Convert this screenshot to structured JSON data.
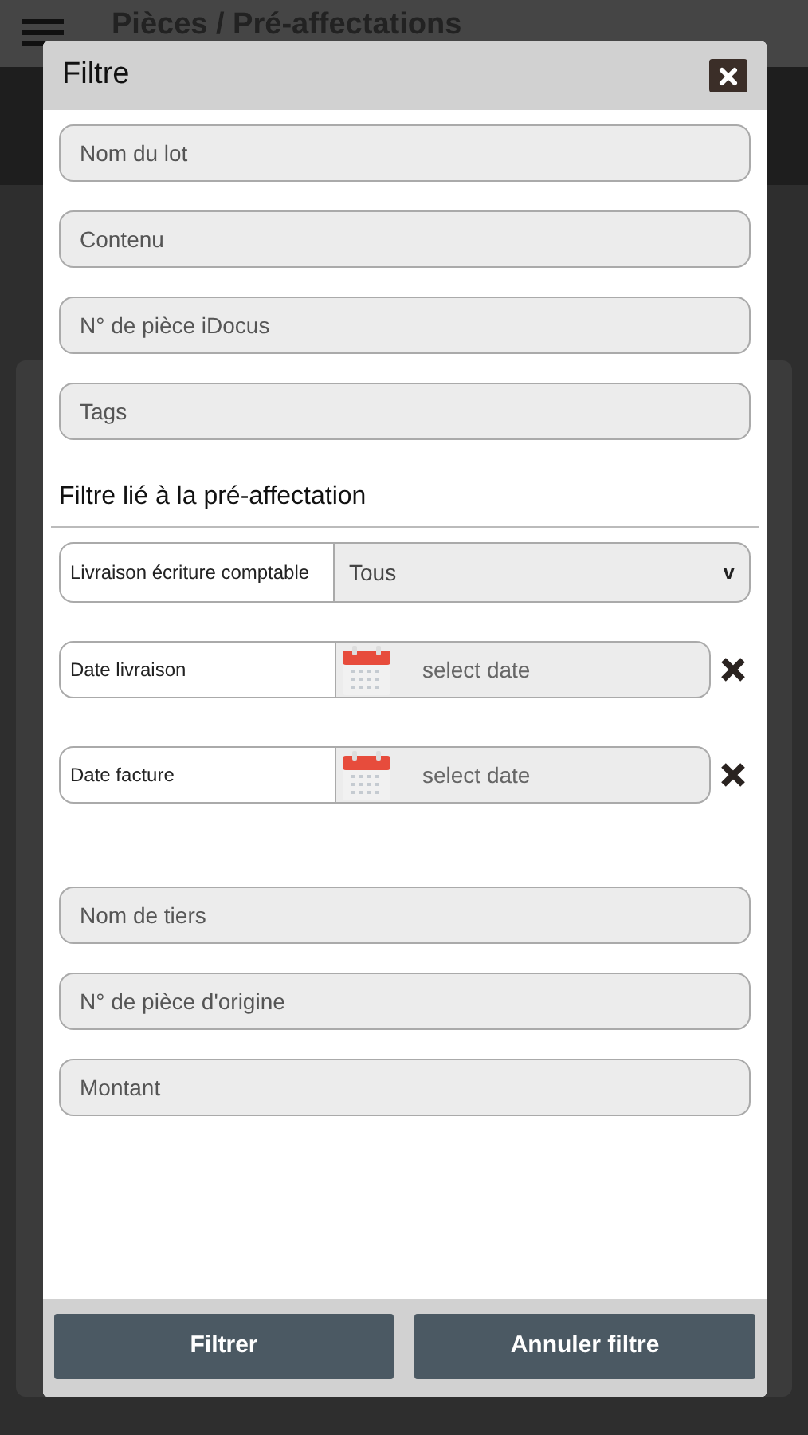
{
  "app_bar": {
    "title": "Pièces / Pré-affectations"
  },
  "dialog": {
    "title": "Filtre",
    "fields": [
      {
        "placeholder": "Nom du lot"
      },
      {
        "placeholder": "Contenu"
      },
      {
        "placeholder": "N° de pièce iDocus"
      },
      {
        "placeholder": "Tags"
      }
    ],
    "section_title": "Filtre lié à la pré-affectation",
    "filters": [
      {
        "kind": "select",
        "label": "Livraison écriture comptable",
        "value": "Tous",
        "caret": "v"
      },
      {
        "kind": "date",
        "label": "Date livraison",
        "placeholder": "select date"
      },
      {
        "kind": "date",
        "label": "Date facture",
        "placeholder": "select date"
      }
    ],
    "more_fields": [
      {
        "placeholder": "Nom de tiers"
      },
      {
        "placeholder": "N° de pièce d'origine"
      },
      {
        "placeholder": "Montant"
      }
    ],
    "buttons": [
      "Filtrer",
      "Annuler filtre"
    ]
  }
}
